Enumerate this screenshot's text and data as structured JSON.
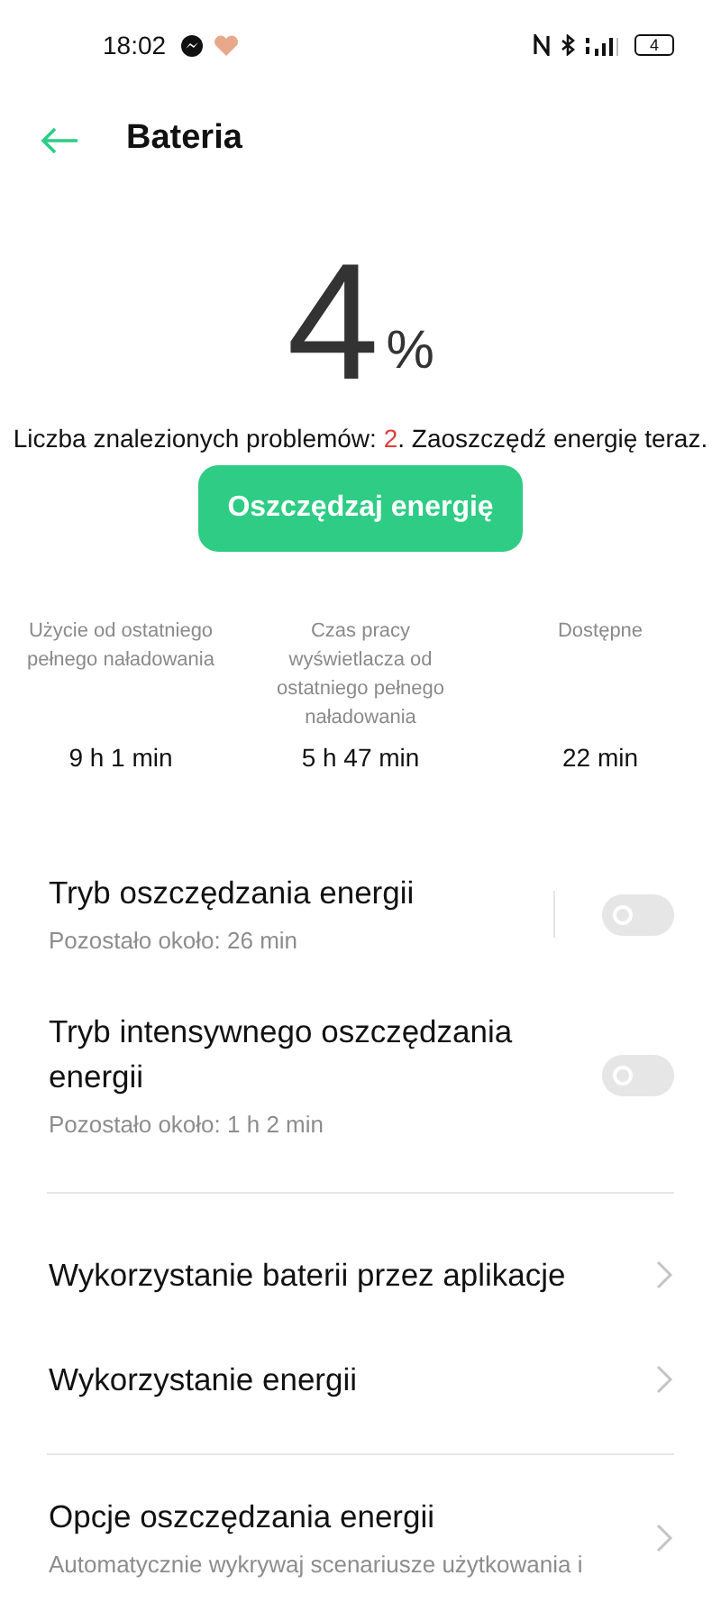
{
  "status_bar": {
    "time": "18:02",
    "battery": "4"
  },
  "header": {
    "title": "Bateria"
  },
  "level": {
    "value": "4",
    "unit": "%"
  },
  "issues": {
    "prefix": "Liczba znalezionych problemów: ",
    "count": "2",
    "suffix": ". Zaoszczędź energię teraz."
  },
  "action_button": "Oszczędzaj energię",
  "stats": [
    {
      "label": "Użycie od ostatniego pełnego naładowania",
      "value": "9 h 1 min"
    },
    {
      "label": "Czas pracy wyświetlacza od ostatniego pełnego naładowania",
      "value": "5 h 47 min"
    },
    {
      "label": "Dostępne",
      "value": "22 min"
    }
  ],
  "toggles": [
    {
      "title": "Tryb oszczędzania energii",
      "subtitle": "Pozostało około:  26 min",
      "on": false
    },
    {
      "title": "Tryb intensywnego oszczędzania energii",
      "subtitle": "Pozostało około:  1 h 2 min",
      "on": false
    }
  ],
  "links": [
    {
      "title": "Wykorzystanie baterii przez aplikacje"
    },
    {
      "title": "Wykorzystanie energii"
    },
    {
      "title": "Opcje oszczędzania energii",
      "subtitle": "Automatycznie wykrywaj scenariusze użytkowania i"
    }
  ]
}
